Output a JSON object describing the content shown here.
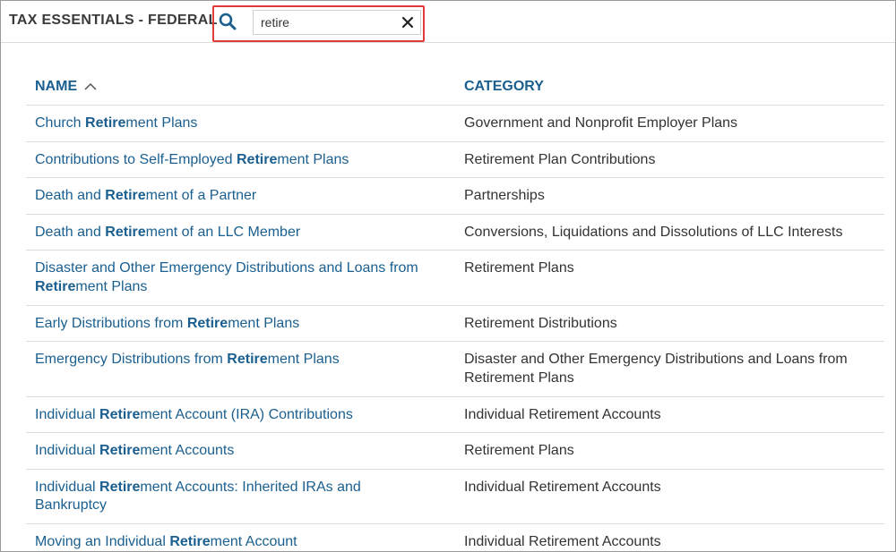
{
  "app": {
    "title": "TAX ESSENTIALS - FEDERAL"
  },
  "search": {
    "value": "retire",
    "icon": "search-icon",
    "clear_icon": "close-icon"
  },
  "colors": {
    "link": "#1a5f8f",
    "highlight_border": "#e03b3b",
    "text": "#333333"
  },
  "table": {
    "columns": {
      "name": "NAME",
      "category": "CATEGORY"
    },
    "sort": {
      "column": "NAME",
      "direction": "ascending"
    },
    "rows": [
      {
        "name": [
          "Church ",
          "Retire",
          "ment Plans"
        ],
        "category": "Government and Nonprofit Employer Plans"
      },
      {
        "name": [
          "Contributions to Self-Employed ",
          "Retire",
          "ment Plans"
        ],
        "category": "Retirement Plan Contributions"
      },
      {
        "name": [
          "Death and ",
          "Retire",
          "ment of a Partner"
        ],
        "category": "Partnerships"
      },
      {
        "name": [
          "Death and ",
          "Retire",
          "ment of an LLC Member"
        ],
        "category": "Conversions, Liquidations and Dissolutions of LLC Interests"
      },
      {
        "name": [
          "Disaster and Other Emergency Distributions and Loans from ",
          "Retire",
          "ment Plans"
        ],
        "category": "Retirement Plans"
      },
      {
        "name": [
          "Early Distributions from ",
          "Retire",
          "ment Plans"
        ],
        "category": "Retirement Distributions"
      },
      {
        "name": [
          "Emergency Distributions from ",
          "Retire",
          "ment Plans"
        ],
        "category": "Disaster and Other Emergency Distributions and Loans from Retirement Plans"
      },
      {
        "name": [
          "Individual ",
          "Retire",
          "ment Account (IRA) Contributions"
        ],
        "category": "Individual Retirement Accounts"
      },
      {
        "name": [
          "Individual ",
          "Retire",
          "ment Accounts"
        ],
        "category": "Retirement Plans"
      },
      {
        "name": [
          "Individual ",
          "Retire",
          "ment Accounts: Inherited IRAs and Bankruptcy"
        ],
        "category": "Individual Retirement Accounts"
      },
      {
        "name": [
          "Moving an Individual ",
          "Retire",
          "ment Account"
        ],
        "category": "Individual Retirement Accounts"
      }
    ]
  }
}
